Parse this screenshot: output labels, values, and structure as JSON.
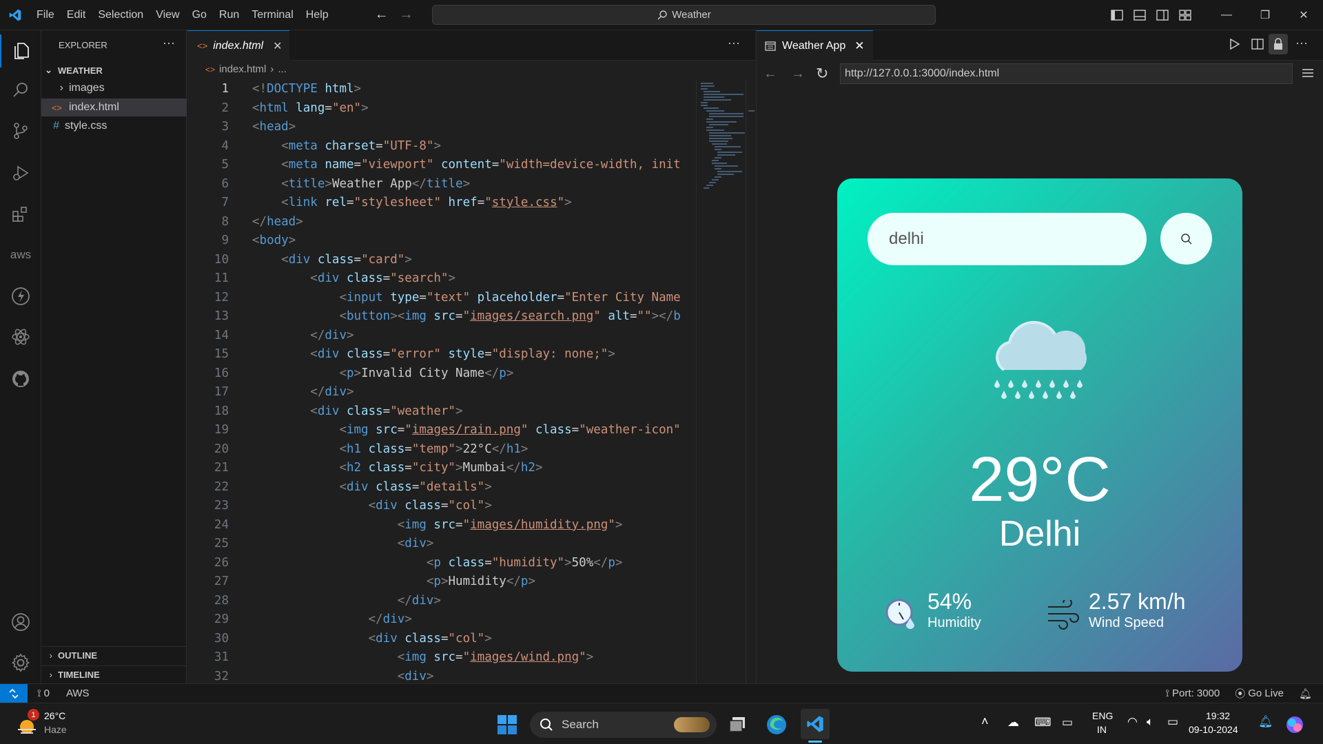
{
  "titlebar": {
    "menu": [
      "File",
      "Edit",
      "Selection",
      "View",
      "Go",
      "Run",
      "Terminal",
      "Help"
    ],
    "command_center": "Weather"
  },
  "explorer": {
    "title": "EXPLORER",
    "folder": "WEATHER",
    "items": [
      "images",
      "index.html",
      "style.css"
    ],
    "outline": "OUTLINE",
    "timeline": "TIMELINE"
  },
  "editor": {
    "tab": "index.html",
    "breadcrumb": [
      "index.html",
      "..."
    ],
    "lines": [
      [
        [
          "g",
          "<!"
        ],
        [
          "t",
          "DOCTYPE"
        ],
        [
          "a",
          " html"
        ],
        [
          "g",
          ">"
        ]
      ],
      [
        [
          "g",
          "<"
        ],
        [
          "t",
          "html"
        ],
        [
          "a",
          " lang"
        ],
        [
          "x",
          "="
        ],
        [
          "s",
          "\"en\""
        ],
        [
          "g",
          ">"
        ]
      ],
      [
        [
          "g",
          "<"
        ],
        [
          "t",
          "head"
        ],
        [
          "g",
          ">"
        ]
      ],
      [
        [
          "x",
          "    "
        ],
        [
          "g",
          "<"
        ],
        [
          "t",
          "meta"
        ],
        [
          "a",
          " charset"
        ],
        [
          "x",
          "="
        ],
        [
          "s",
          "\"UTF-8\""
        ],
        [
          "g",
          ">"
        ]
      ],
      [
        [
          "x",
          "    "
        ],
        [
          "g",
          "<"
        ],
        [
          "t",
          "meta"
        ],
        [
          "a",
          " name"
        ],
        [
          "x",
          "="
        ],
        [
          "s",
          "\"viewport\""
        ],
        [
          "a",
          " content"
        ],
        [
          "x",
          "="
        ],
        [
          "s",
          "\"width=device-width, init"
        ]
      ],
      [
        [
          "x",
          "    "
        ],
        [
          "g",
          "<"
        ],
        [
          "t",
          "title"
        ],
        [
          "g",
          ">"
        ],
        [
          "x",
          "Weather App"
        ],
        [
          "g",
          "</"
        ],
        [
          "t",
          "title"
        ],
        [
          "g",
          ">"
        ]
      ],
      [
        [
          "x",
          "    "
        ],
        [
          "g",
          "<"
        ],
        [
          "t",
          "link"
        ],
        [
          "a",
          " rel"
        ],
        [
          "x",
          "="
        ],
        [
          "s",
          "\"stylesheet\""
        ],
        [
          "a",
          " href"
        ],
        [
          "x",
          "="
        ],
        [
          "s",
          "\""
        ],
        [
          "su",
          "style.css"
        ],
        [
          "s",
          "\""
        ],
        [
          "g",
          ">"
        ]
      ],
      [
        [
          "g",
          "</"
        ],
        [
          "t",
          "head"
        ],
        [
          "g",
          ">"
        ]
      ],
      [
        [
          "g",
          "<"
        ],
        [
          "t",
          "body"
        ],
        [
          "g",
          ">"
        ]
      ],
      [
        [
          "x",
          "    "
        ],
        [
          "g",
          "<"
        ],
        [
          "t",
          "div"
        ],
        [
          "a",
          " class"
        ],
        [
          "x",
          "="
        ],
        [
          "s",
          "\"card\""
        ],
        [
          "g",
          ">"
        ]
      ],
      [
        [
          "x",
          "        "
        ],
        [
          "g",
          "<"
        ],
        [
          "t",
          "div"
        ],
        [
          "a",
          " class"
        ],
        [
          "x",
          "="
        ],
        [
          "s",
          "\"search\""
        ],
        [
          "g",
          ">"
        ]
      ],
      [
        [
          "x",
          "            "
        ],
        [
          "g",
          "<"
        ],
        [
          "t",
          "input"
        ],
        [
          "a",
          " type"
        ],
        [
          "x",
          "="
        ],
        [
          "s",
          "\"text\""
        ],
        [
          "a",
          " placeholder"
        ],
        [
          "x",
          "="
        ],
        [
          "s",
          "\"Enter City Name"
        ]
      ],
      [
        [
          "x",
          "            "
        ],
        [
          "g",
          "<"
        ],
        [
          "t",
          "button"
        ],
        [
          "g",
          "><"
        ],
        [
          "t",
          "img"
        ],
        [
          "a",
          " src"
        ],
        [
          "x",
          "="
        ],
        [
          "s",
          "\""
        ],
        [
          "su",
          "images/search.png"
        ],
        [
          "s",
          "\""
        ],
        [
          "a",
          " alt"
        ],
        [
          "x",
          "="
        ],
        [
          "s",
          "\"\""
        ],
        [
          "g",
          "></"
        ],
        [
          "t",
          "b"
        ]
      ],
      [
        [
          "x",
          "        "
        ],
        [
          "g",
          "</"
        ],
        [
          "t",
          "div"
        ],
        [
          "g",
          ">"
        ]
      ],
      [
        [
          "x",
          "        "
        ],
        [
          "g",
          "<"
        ],
        [
          "t",
          "div"
        ],
        [
          "a",
          " class"
        ],
        [
          "x",
          "="
        ],
        [
          "s",
          "\"error\""
        ],
        [
          "a",
          " style"
        ],
        [
          "x",
          "="
        ],
        [
          "s",
          "\"display: none;\""
        ],
        [
          "g",
          ">"
        ]
      ],
      [
        [
          "x",
          "            "
        ],
        [
          "g",
          "<"
        ],
        [
          "t",
          "p"
        ],
        [
          "g",
          ">"
        ],
        [
          "x",
          "Invalid City Name"
        ],
        [
          "g",
          "</"
        ],
        [
          "t",
          "p"
        ],
        [
          "g",
          ">"
        ]
      ],
      [
        [
          "x",
          "        "
        ],
        [
          "g",
          "</"
        ],
        [
          "t",
          "div"
        ],
        [
          "g",
          ">"
        ]
      ],
      [
        [
          "x",
          "        "
        ],
        [
          "g",
          "<"
        ],
        [
          "t",
          "div"
        ],
        [
          "a",
          " class"
        ],
        [
          "x",
          "="
        ],
        [
          "s",
          "\"weather\""
        ],
        [
          "g",
          ">"
        ]
      ],
      [
        [
          "x",
          "            "
        ],
        [
          "g",
          "<"
        ],
        [
          "t",
          "img"
        ],
        [
          "a",
          " src"
        ],
        [
          "x",
          "="
        ],
        [
          "s",
          "\""
        ],
        [
          "su",
          "images/rain.png"
        ],
        [
          "s",
          "\""
        ],
        [
          "a",
          " class"
        ],
        [
          "x",
          "="
        ],
        [
          "s",
          "\"weather-icon\""
        ]
      ],
      [
        [
          "x",
          "            "
        ],
        [
          "g",
          "<"
        ],
        [
          "t",
          "h1"
        ],
        [
          "a",
          " class"
        ],
        [
          "x",
          "="
        ],
        [
          "s",
          "\"temp\""
        ],
        [
          "g",
          ">"
        ],
        [
          "x",
          "22°C"
        ],
        [
          "g",
          "</"
        ],
        [
          "t",
          "h1"
        ],
        [
          "g",
          ">"
        ]
      ],
      [
        [
          "x",
          "            "
        ],
        [
          "g",
          "<"
        ],
        [
          "t",
          "h2"
        ],
        [
          "a",
          " class"
        ],
        [
          "x",
          "="
        ],
        [
          "s",
          "\"city\""
        ],
        [
          "g",
          ">"
        ],
        [
          "x",
          "Mumbai"
        ],
        [
          "g",
          "</"
        ],
        [
          "t",
          "h2"
        ],
        [
          "g",
          ">"
        ]
      ],
      [
        [
          "x",
          "            "
        ],
        [
          "g",
          "<"
        ],
        [
          "t",
          "div"
        ],
        [
          "a",
          " class"
        ],
        [
          "x",
          "="
        ],
        [
          "s",
          "\"details\""
        ],
        [
          "g",
          ">"
        ]
      ],
      [
        [
          "x",
          "                "
        ],
        [
          "g",
          "<"
        ],
        [
          "t",
          "div"
        ],
        [
          "a",
          " class"
        ],
        [
          "x",
          "="
        ],
        [
          "s",
          "\"col\""
        ],
        [
          "g",
          ">"
        ]
      ],
      [
        [
          "x",
          "                    "
        ],
        [
          "g",
          "<"
        ],
        [
          "t",
          "img"
        ],
        [
          "a",
          " src"
        ],
        [
          "x",
          "="
        ],
        [
          "s",
          "\""
        ],
        [
          "su",
          "images/humidity.png"
        ],
        [
          "s",
          "\""
        ],
        [
          "g",
          ">"
        ]
      ],
      [
        [
          "x",
          "                    "
        ],
        [
          "g",
          "<"
        ],
        [
          "t",
          "div"
        ],
        [
          "g",
          ">"
        ]
      ],
      [
        [
          "x",
          "                        "
        ],
        [
          "g",
          "<"
        ],
        [
          "t",
          "p"
        ],
        [
          "a",
          " class"
        ],
        [
          "x",
          "="
        ],
        [
          "s",
          "\"humidity\""
        ],
        [
          "g",
          ">"
        ],
        [
          "x",
          "50%"
        ],
        [
          "g",
          "</"
        ],
        [
          "t",
          "p"
        ],
        [
          "g",
          ">"
        ]
      ],
      [
        [
          "x",
          "                        "
        ],
        [
          "g",
          "<"
        ],
        [
          "t",
          "p"
        ],
        [
          "g",
          ">"
        ],
        [
          "x",
          "Humidity"
        ],
        [
          "g",
          "</"
        ],
        [
          "t",
          "p"
        ],
        [
          "g",
          ">"
        ]
      ],
      [
        [
          "x",
          "                    "
        ],
        [
          "g",
          "</"
        ],
        [
          "t",
          "div"
        ],
        [
          "g",
          ">"
        ]
      ],
      [
        [
          "x",
          "                "
        ],
        [
          "g",
          "</"
        ],
        [
          "t",
          "div"
        ],
        [
          "g",
          ">"
        ]
      ],
      [
        [
          "x",
          "                "
        ],
        [
          "g",
          "<"
        ],
        [
          "t",
          "div"
        ],
        [
          "a",
          " class"
        ],
        [
          "x",
          "="
        ],
        [
          "s",
          "\"col\""
        ],
        [
          "g",
          ">"
        ]
      ],
      [
        [
          "x",
          "                    "
        ],
        [
          "g",
          "<"
        ],
        [
          "t",
          "img"
        ],
        [
          "a",
          " src"
        ],
        [
          "x",
          "="
        ],
        [
          "s",
          "\""
        ],
        [
          "su",
          "images/wind.png"
        ],
        [
          "s",
          "\""
        ],
        [
          "g",
          ">"
        ]
      ],
      [
        [
          "x",
          "                    "
        ],
        [
          "g",
          "<"
        ],
        [
          "t",
          "div"
        ],
        [
          "g",
          ">"
        ]
      ]
    ]
  },
  "preview": {
    "tab": "Weather App",
    "url": "http://127.0.0.1:3000/index.html",
    "search_value": "delhi",
    "search_placeholder": "Enter City Name",
    "temp": "29°C",
    "city": "Delhi",
    "humidity_value": "54%",
    "humidity_label": "Humidity",
    "wind_value": "2.57 km/h",
    "wind_label": "Wind Speed"
  },
  "statusbar": {
    "ports": "0",
    "aws": "AWS",
    "port": "Port: 3000",
    "golive": "Go Live"
  },
  "taskbar": {
    "weather_temp": "26°C",
    "weather_desc": "Haze",
    "weather_badge": "1",
    "search": "Search",
    "lang1": "ENG",
    "lang2": "IN",
    "time": "19:32",
    "date": "09-10-2024"
  },
  "colors": {
    "accent": "#0078d4",
    "card_top": "#00f2c3",
    "card_bottom": "#5b6aa4"
  }
}
